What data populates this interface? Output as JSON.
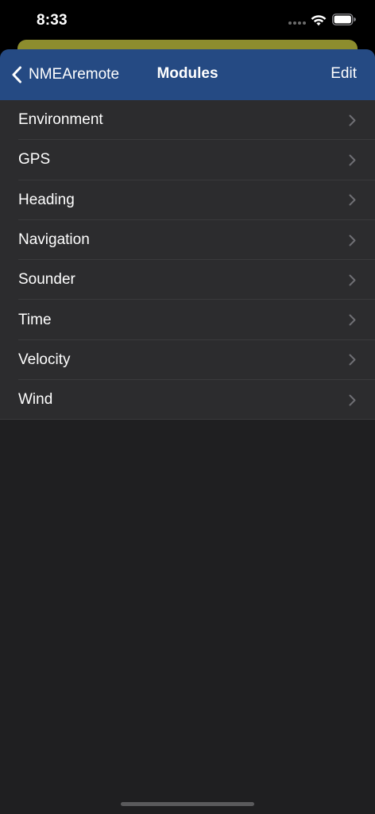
{
  "status_bar": {
    "time": "8:33"
  },
  "nav": {
    "back_label": "NMEAremote",
    "title": "Modules",
    "edit_label": "Edit"
  },
  "modules": [
    {
      "label": "Environment"
    },
    {
      "label": "GPS"
    },
    {
      "label": "Heading"
    },
    {
      "label": "Navigation"
    },
    {
      "label": "Sounder"
    },
    {
      "label": "Time"
    },
    {
      "label": "Velocity"
    },
    {
      "label": "Wind"
    }
  ],
  "icons": {
    "back": "chevron-left-icon",
    "row_disclosure": "chevron-right-icon",
    "wifi": "wifi-icon",
    "battery": "battery-icon"
  },
  "colors": {
    "nav_bar": "#254a83",
    "list_row": "#2c2c2e",
    "sheet_background": "#1f1f21",
    "background_card": "#8d8d2e",
    "separator": "#3a3a3c"
  }
}
